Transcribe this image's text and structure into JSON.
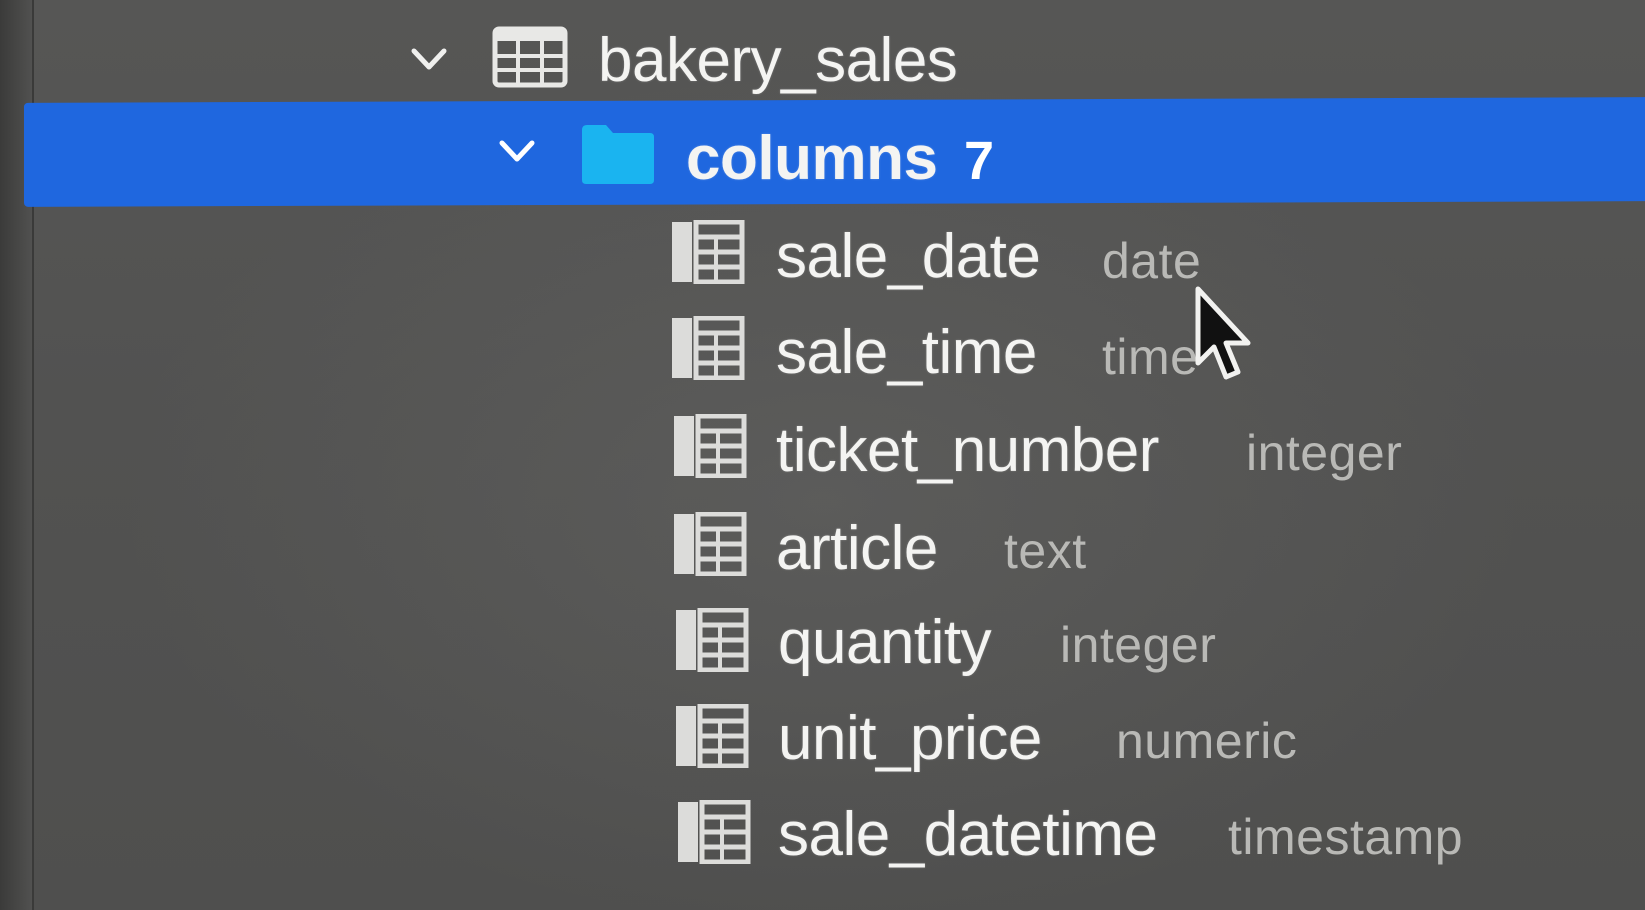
{
  "tree": {
    "table": {
      "name": "bakery_sales",
      "icon": "table-icon",
      "expanded": true
    },
    "columns_folder": {
      "label": "columns",
      "count": "7",
      "icon": "folder-icon",
      "expanded": true,
      "selected": true
    },
    "columns": [
      {
        "name": "sale_date",
        "type": "date"
      },
      {
        "name": "sale_time",
        "type": "time"
      },
      {
        "name": "ticket_number",
        "type": "integer"
      },
      {
        "name": "article",
        "type": "text"
      },
      {
        "name": "quantity",
        "type": "integer"
      },
      {
        "name": "unit_price",
        "type": "numeric"
      },
      {
        "name": "sale_datetime",
        "type": "timestamp"
      }
    ]
  },
  "colors": {
    "selection": "#1f67df",
    "folder": "#1ab4f0",
    "background": "#545453",
    "label_text": "#f4f4f2",
    "type_text": "#b9b9b6"
  }
}
